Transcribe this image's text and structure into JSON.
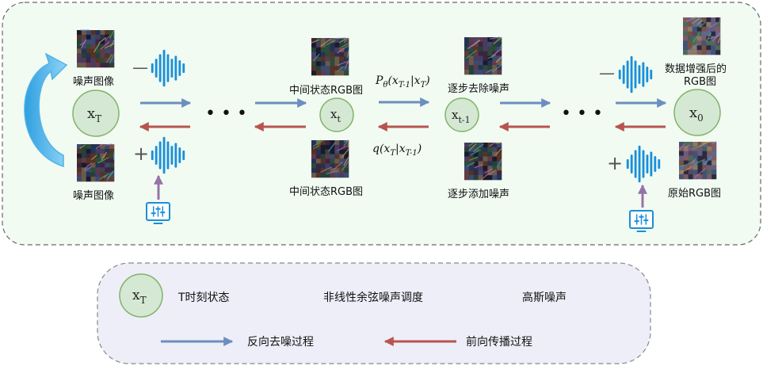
{
  "colors": {
    "panel_fill": "#f1fbf2",
    "legend_fill": "#eeeef9",
    "node_fill": "#d5e8d4",
    "node_stroke": "#82b366",
    "reverse_arrow": "#6c8ebf",
    "forward_arrow": "#b85450",
    "wave": "#1a8fd8",
    "scheduler_icon": "#1a8fd8",
    "purple_arrow": "#9673a6",
    "curved_arrow": "#4fb3e8"
  },
  "nodes": {
    "xT": {
      "main": "x",
      "sub": "T"
    },
    "xt": {
      "main": "x",
      "sub": "t"
    },
    "xt1": {
      "main": "x",
      "sub": "t-1"
    },
    "x0": {
      "main": "x",
      "sub": "0"
    }
  },
  "labels": {
    "noise_top": "噪声图像",
    "noise_bottom": "噪声图像",
    "mid_top": "中间状态RGB图",
    "mid_bottom": "中间状态RGB图",
    "denoise_step": "逐步去除噪声",
    "add_noise_step": "逐步添加噪声",
    "augmented_line1": "数据增强后的",
    "augmented_line2": "RGB图",
    "original": "原始RGB图"
  },
  "signs": {
    "minus": "—",
    "plus": "+"
  },
  "formulas": {
    "p_theta": {
      "P": "P",
      "theta": "θ",
      "body": "(x",
      "s1": "T-1",
      "mid": "|x",
      "s2": "T",
      "end": ")"
    },
    "q": {
      "q": "q(x",
      "s1": "T",
      "mid": "|x",
      "s2": "T-1",
      "end": ")"
    }
  },
  "ellipsis": "• • •",
  "legend": {
    "state_node": {
      "main": "x",
      "sub": "T"
    },
    "state": "T时刻状态",
    "schedule": "非线性余弦噪声调度",
    "gaussian": "高斯噪声",
    "reverse": "反向去噪过程",
    "forward": "前向传播过程"
  }
}
